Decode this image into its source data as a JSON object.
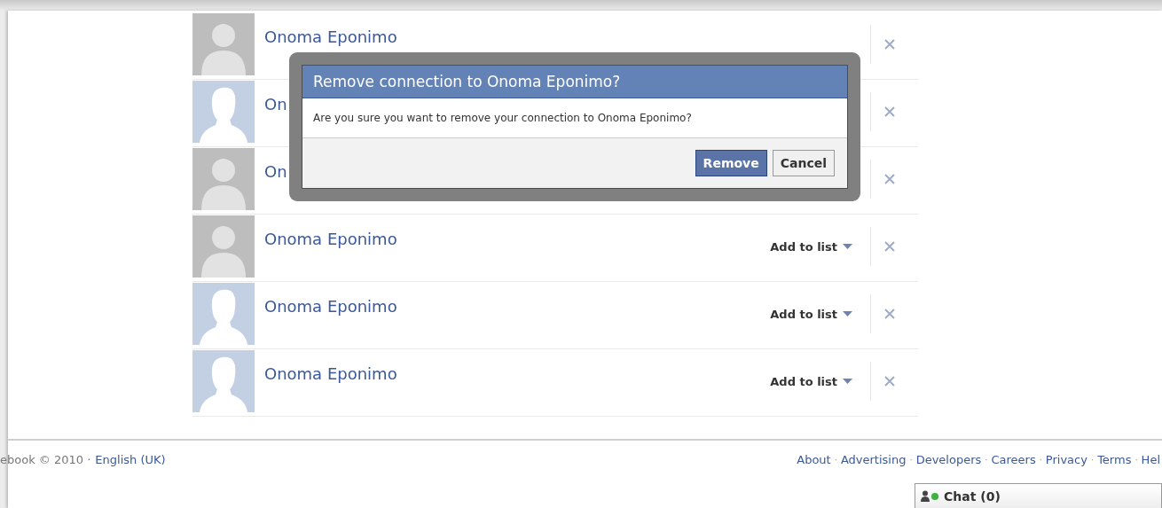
{
  "connections": [
    {
      "name": "Onoma Eponimo",
      "kind": "generic"
    },
    {
      "name": "On",
      "kind": "silhouette"
    },
    {
      "name": "On",
      "kind": "generic"
    },
    {
      "name": "Onoma Eponimo",
      "kind": "generic",
      "add_to_list": "Add to list"
    },
    {
      "name": "Onoma Eponimo",
      "kind": "silhouette",
      "add_to_list": "Add to list"
    },
    {
      "name": "Onoma Eponimo",
      "kind": "silhouette",
      "add_to_list": "Add to list"
    }
  ],
  "dialog": {
    "title": "Remove connection to Onoma Eponimo?",
    "message": "Are you sure you want to remove your connection to Onoma Eponimo?",
    "buttons": [
      {
        "label": "Remove",
        "kind": "primary"
      },
      {
        "label": "Cancel",
        "kind": "secondary"
      }
    ]
  },
  "footer": {
    "copyright": "ebook © 2010 ·",
    "language": "English (UK)",
    "separator": "·",
    "links": [
      "About",
      "Advertising",
      "Developers",
      "Careers",
      "Privacy",
      "Terms",
      "Hel"
    ]
  },
  "chat": {
    "label": "Chat (0)"
  }
}
